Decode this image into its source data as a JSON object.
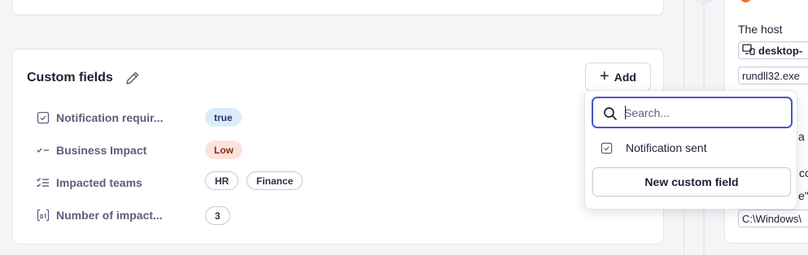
{
  "custom_fields": {
    "title": "Custom fields",
    "add_label": "Add",
    "fields": [
      {
        "icon": "checkbox-icon",
        "label": "Notification requir...",
        "values": [
          "true"
        ],
        "style": "blue"
      },
      {
        "icon": "single-select-icon",
        "label": "Business Impact",
        "values": [
          "Low"
        ],
        "style": "red"
      },
      {
        "icon": "multi-select-icon",
        "label": "Impacted teams",
        "values": [
          "HR",
          "Finance"
        ],
        "style": "outline"
      },
      {
        "icon": "number-icon",
        "label": "Number of impact...",
        "values": [
          "3"
        ],
        "style": "outline"
      }
    ]
  },
  "dropdown": {
    "search_placeholder": "Search...",
    "search_value": "",
    "option_label": "Notification sent",
    "new_button_label": "New custom field"
  },
  "side": {
    "host_text": "The host",
    "device_chip": "desktop-",
    "process_chip": "rundll32.exe",
    "frag_a": "a C",
    "frag_b": "cc",
    "frag_c": "e\"",
    "path_chip": "C:\\Windows\\"
  },
  "colors": {
    "accent": "#4b55c6",
    "true_pill": "#dcebfb",
    "low_pill": "#fbe3dc",
    "orange": "#f26b21"
  }
}
